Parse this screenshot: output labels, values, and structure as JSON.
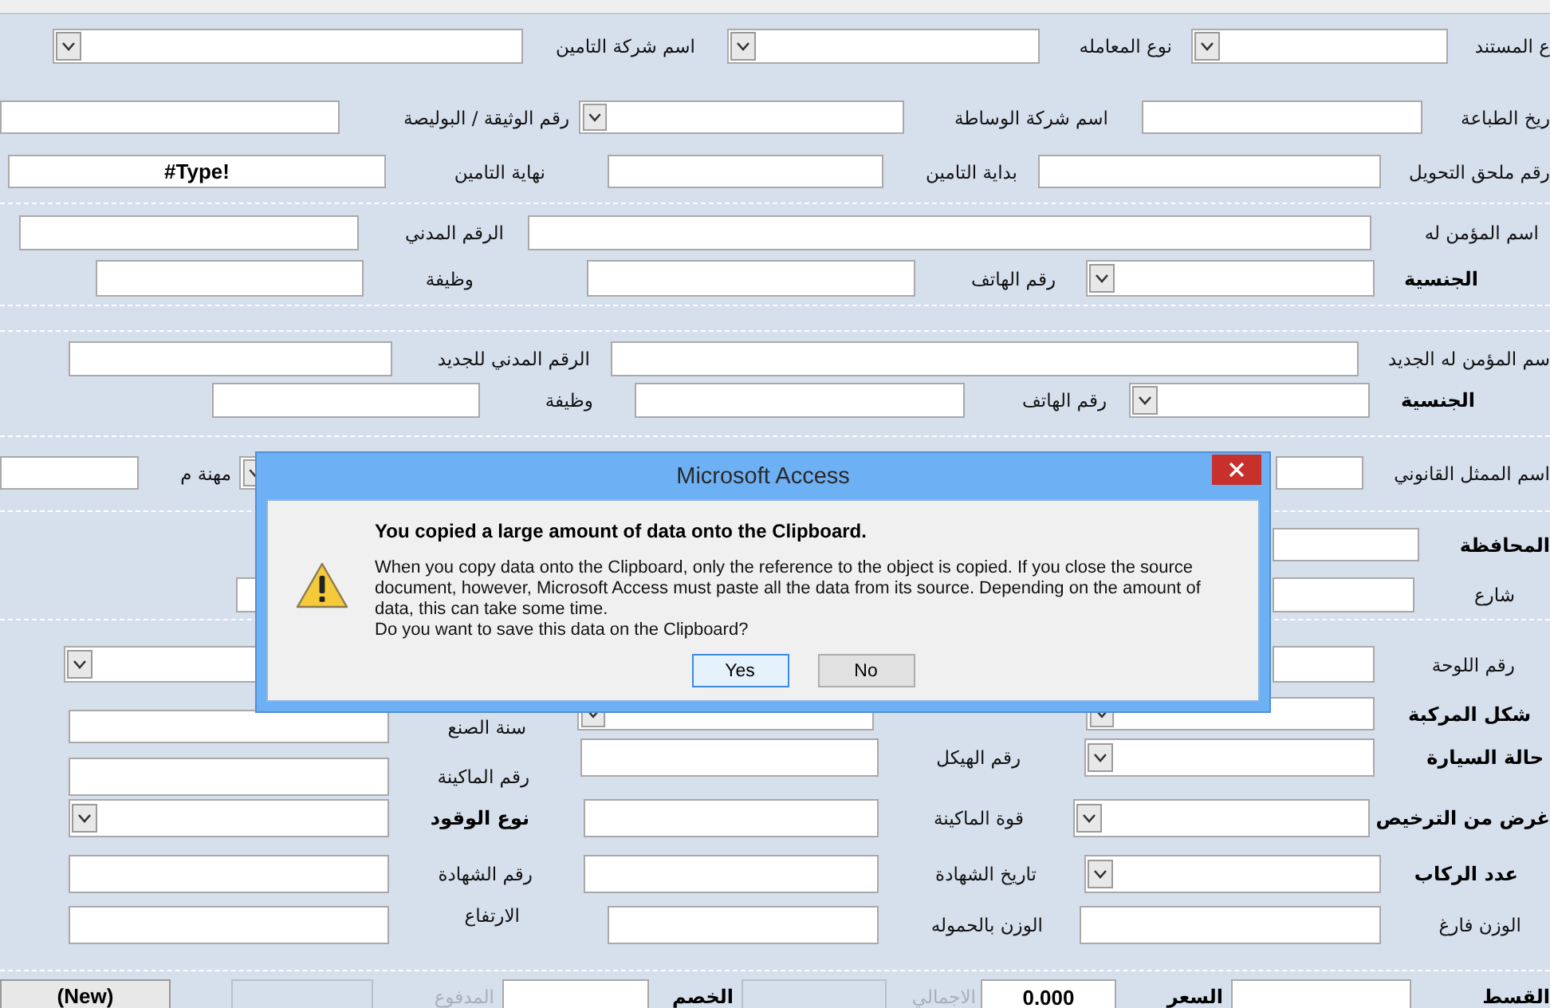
{
  "form": {
    "rows": [
      {
        "items": [
          {
            "kind": "label",
            "text": "ع المستند",
            "bold": false
          },
          {
            "kind": "combo"
          },
          {
            "kind": "label",
            "text": "نوع المعامله",
            "bold": false
          },
          {
            "kind": "combo"
          },
          {
            "kind": "label",
            "text": "اسم شركة التامين",
            "bold": false
          },
          {
            "kind": "combo"
          }
        ]
      },
      {
        "items": [
          {
            "kind": "label",
            "text": "ريخ الطباعة",
            "bold": false
          },
          {
            "kind": "textbox"
          },
          {
            "kind": "label",
            "text": "اسم شركة الوساطة",
            "bold": false
          },
          {
            "kind": "combo"
          },
          {
            "kind": "label",
            "text": "رقم الوثيقة / البوليصة",
            "bold": false
          },
          {
            "kind": "textbox"
          }
        ]
      },
      {
        "items": [
          {
            "kind": "label",
            "text": "رقم ملحق التحويل",
            "bold": false
          },
          {
            "kind": "textbox"
          },
          {
            "kind": "label",
            "text": "بداية التامين",
            "bold": false
          },
          {
            "kind": "textbox"
          },
          {
            "kind": "label",
            "text": "نهاية التامين",
            "bold": false
          },
          {
            "kind": "textbox",
            "value": "#Type!"
          }
        ]
      },
      {
        "items": [
          {
            "kind": "label",
            "text": "اسم المؤمن له",
            "bold": false
          },
          {
            "kind": "textbox"
          },
          {
            "kind": "label",
            "text": "الرقم المدني",
            "bold": false
          },
          {
            "kind": "textbox"
          }
        ]
      },
      {
        "items": [
          {
            "kind": "label",
            "text": "الجنسية",
            "bold": true
          },
          {
            "kind": "combo"
          },
          {
            "kind": "label",
            "text": "رقم الهاتف",
            "bold": false
          },
          {
            "kind": "textbox"
          },
          {
            "kind": "label",
            "text": "وظيفة",
            "bold": false
          },
          {
            "kind": "textbox"
          }
        ]
      },
      {
        "items": [
          {
            "kind": "label",
            "text": "سم المؤمن له الجديد",
            "bold": false
          },
          {
            "kind": "textbox"
          },
          {
            "kind": "label",
            "text": "الرقم المدني للجديد",
            "bold": false
          },
          {
            "kind": "textbox"
          }
        ]
      },
      {
        "items": [
          {
            "kind": "label",
            "text": "الجنسية",
            "bold": true
          },
          {
            "kind": "combo"
          },
          {
            "kind": "label",
            "text": "رقم الهاتف",
            "bold": false
          },
          {
            "kind": "textbox"
          },
          {
            "kind": "label",
            "text": "وظيفة",
            "bold": false
          },
          {
            "kind": "textbox"
          }
        ]
      },
      {
        "items": [
          {
            "kind": "label",
            "text": "اسم الممثل القانوني",
            "bold": false
          },
          {
            "kind": "textbox"
          },
          {
            "kind": "combo"
          },
          {
            "kind": "label",
            "text": "مهنة م",
            "bold": false
          },
          {
            "kind": "textbox"
          }
        ]
      },
      {
        "items": [
          {
            "kind": "label",
            "text": "المحافظة",
            "bold": true
          },
          {
            "kind": "textbox"
          }
        ]
      },
      {
        "items": [
          {
            "kind": "label",
            "text": "شارع",
            "bold": false
          },
          {
            "kind": "textbox"
          },
          {
            "kind": "textbox"
          }
        ]
      },
      {
        "items": [
          {
            "kind": "label",
            "text": "رقم اللوحة",
            "bold": false
          },
          {
            "kind": "textbox"
          },
          {
            "kind": "combo"
          }
        ]
      },
      {
        "items": [
          {
            "kind": "label",
            "text": "شكل المركبة",
            "bold": true
          },
          {
            "kind": "combo"
          },
          {
            "kind": "combo"
          },
          {
            "kind": "label",
            "text": "سنة الصنع",
            "bold": false
          },
          {
            "kind": "textbox"
          }
        ]
      },
      {
        "items": [
          {
            "kind": "label",
            "text": "حالة السيارة",
            "bold": true
          },
          {
            "kind": "combo"
          },
          {
            "kind": "label",
            "text": "رقم الهيكل",
            "bold": false
          },
          {
            "kind": "textbox"
          },
          {
            "kind": "label",
            "text": "رقم الماكينة",
            "bold": false
          },
          {
            "kind": "textbox"
          }
        ]
      },
      {
        "items": [
          {
            "kind": "label",
            "text": "غرض من الترخيص",
            "bold": true
          },
          {
            "kind": "combo"
          },
          {
            "kind": "label",
            "text": "قوة الماكينة",
            "bold": false
          },
          {
            "kind": "textbox"
          },
          {
            "kind": "label",
            "text": "نوع الوقود",
            "bold": true
          },
          {
            "kind": "combo"
          }
        ]
      },
      {
        "items": [
          {
            "kind": "label",
            "text": "عدد الركاب",
            "bold": true
          },
          {
            "kind": "combo"
          },
          {
            "kind": "label",
            "text": "تاريخ الشهادة",
            "bold": false
          },
          {
            "kind": "textbox"
          },
          {
            "kind": "label",
            "text": "رقم الشهادة",
            "bold": false
          },
          {
            "kind": "textbox"
          }
        ]
      },
      {
        "items": [
          {
            "kind": "label",
            "text": "الوزن فارغ",
            "bold": false
          },
          {
            "kind": "textbox"
          },
          {
            "kind": "label",
            "text": "الوزن بالحموله",
            "bold": false
          },
          {
            "kind": "textbox"
          },
          {
            "kind": "label",
            "text": "الارتفاع",
            "bold": false
          },
          {
            "kind": "textbox"
          }
        ]
      },
      {
        "items": [
          {
            "kind": "label",
            "text": "القسط",
            "bold": true
          },
          {
            "kind": "textbox"
          },
          {
            "kind": "label",
            "text": "السعر",
            "bold": true
          },
          {
            "kind": "textbox",
            "value": "0.000"
          },
          {
            "kind": "label",
            "text": "الاجمالي",
            "bold": false,
            "disabled": true
          },
          {
            "kind": "textbox",
            "disabled": true
          },
          {
            "kind": "label",
            "text": "الخصم",
            "bold": true
          },
          {
            "kind": "textbox"
          },
          {
            "kind": "label",
            "text": "المدفوع",
            "bold": false,
            "disabled": true
          },
          {
            "kind": "textbox",
            "disabled": true
          },
          {
            "kind": "button",
            "text": "(New)"
          }
        ]
      }
    ]
  },
  "dialog": {
    "title": "Microsoft Access",
    "heading": "You copied a large amount of data onto the Clipboard.",
    "message": "When you copy data onto the Clipboard, only the reference to the object is copied. If you close the source document, however, Microsoft Access must paste all the data from its source. Depending on the amount of data, this can take some time.",
    "question": "Do you want to save this data on the Clipboard?",
    "buttons": [
      {
        "text": "No",
        "selected": false
      },
      {
        "text": "Yes",
        "selected": true
      }
    ]
  }
}
